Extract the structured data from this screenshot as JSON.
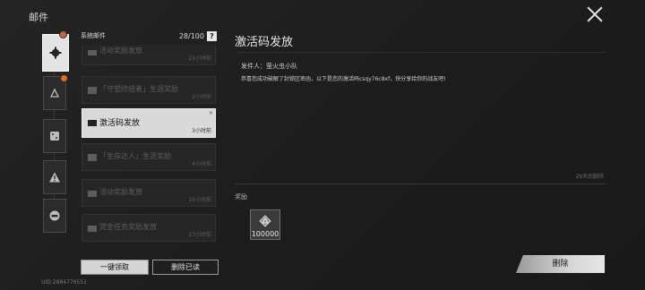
{
  "header": {
    "title": "邮件"
  },
  "list": {
    "heading": "系统邮件",
    "count": "28/100",
    "help": "?",
    "items": [
      {
        "subject": "活动奖励发放",
        "time": "23小时前"
      },
      {
        "subject": "「守望终结者」生涯奖励",
        "time": "2小时前"
      },
      {
        "subject": "激活码发放",
        "time": "3小时前",
        "corner": "×"
      },
      {
        "subject": "「生存达人」生涯奖励",
        "time": "4小时前"
      },
      {
        "subject": "活动奖励发放",
        "time": "16小时前"
      },
      {
        "subject": "赏金任务奖励发放",
        "time": "17小时前"
      }
    ]
  },
  "buttons": {
    "claim_all": "一键领取",
    "delete_read": "删除已读"
  },
  "footer": {
    "uid": "UID:2884776551"
  },
  "detail": {
    "title": "激活码发放",
    "sender": "发件人：萤火虫小队",
    "body": "恭喜您成功破解了封锁区密函，以下是您的激活码csqy76c8xf，快分享给你的战友吧!",
    "expire": "29天后删除",
    "reward_label": "奖励",
    "reward_qty": "100000",
    "delete": "删除"
  },
  "colors": {
    "accent": "#e36a27"
  }
}
